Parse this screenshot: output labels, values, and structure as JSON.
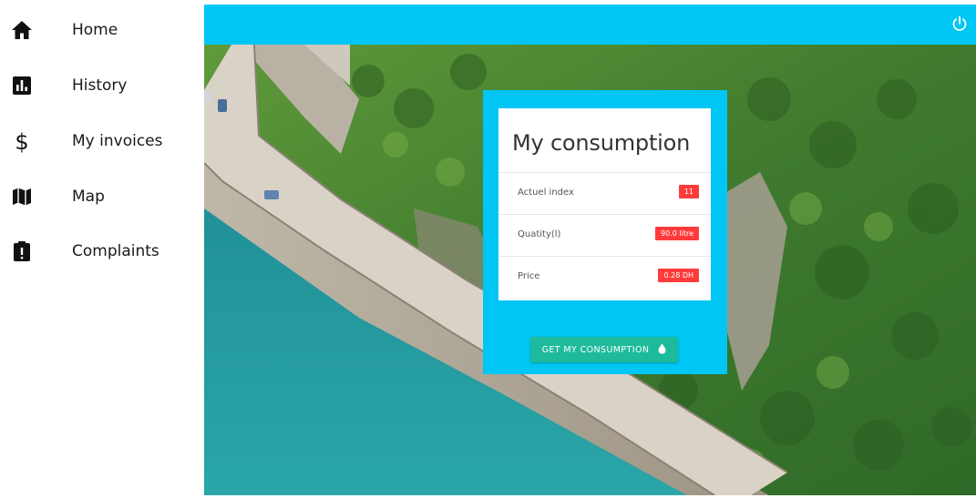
{
  "sidebar": {
    "items": [
      {
        "label": "Home",
        "icon": "home-icon"
      },
      {
        "label": "History",
        "icon": "bar-chart-icon"
      },
      {
        "label": "My invoices",
        "icon": "dollar-icon"
      },
      {
        "label": "Map",
        "icon": "map-icon"
      },
      {
        "label": "Complaints",
        "icon": "clipboard-alert-icon"
      }
    ]
  },
  "topbar": {
    "color": "#00c6f5",
    "power_icon": "power-icon"
  },
  "card": {
    "title": "My consumption",
    "rows": [
      {
        "label": "Actuel index",
        "value": "11"
      },
      {
        "label": "Quatity(l)",
        "value": "90.0 litre"
      },
      {
        "label": "Price",
        "value": "0.28 DH"
      }
    ],
    "button_label": "GET MY CONSUMPTION",
    "button_icon": "water-drop-icon",
    "badge_color": "#ff3b3b",
    "button_color": "#1dbb9b"
  }
}
